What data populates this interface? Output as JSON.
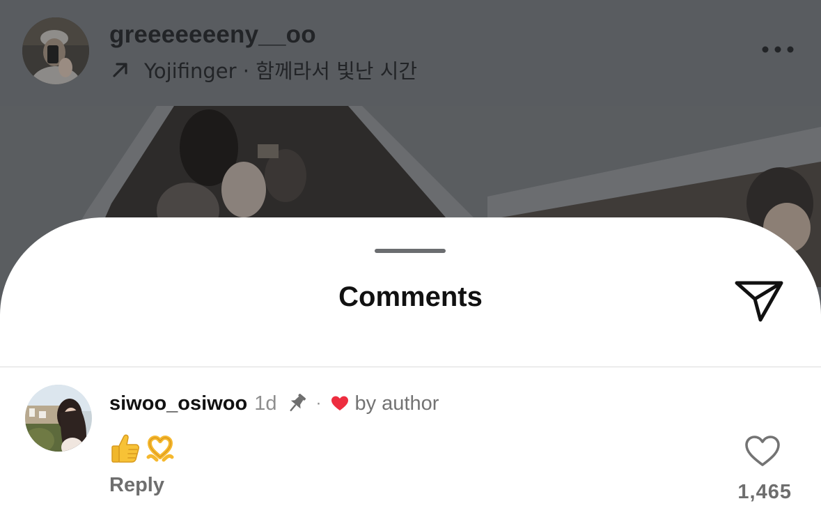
{
  "post": {
    "username": "greeeeeeeny__oo",
    "music": "Yojifinger · 함께라서 빛난 시간",
    "icons": {
      "avatar": "user-photo",
      "music": "arrow-up-right-icon",
      "more": "more-horizontal-icon"
    }
  },
  "sheet": {
    "title": "Comments",
    "share_icon": "send-icon"
  },
  "comments": [
    {
      "username": "siwoo_osiwoo",
      "time": "1d",
      "pinned": true,
      "separator": "·",
      "liked_by_author_label": "by author",
      "body_emojis": [
        "thumbs-up-emoji",
        "heart-hands-emoji"
      ],
      "reply_label": "Reply",
      "like_count": "1,465"
    }
  ],
  "colors": {
    "overlay": "#595c60",
    "author_heart": "#ed2d3f",
    "secondary_text": "#8e8e8e",
    "divider": "#dbdbdb"
  }
}
